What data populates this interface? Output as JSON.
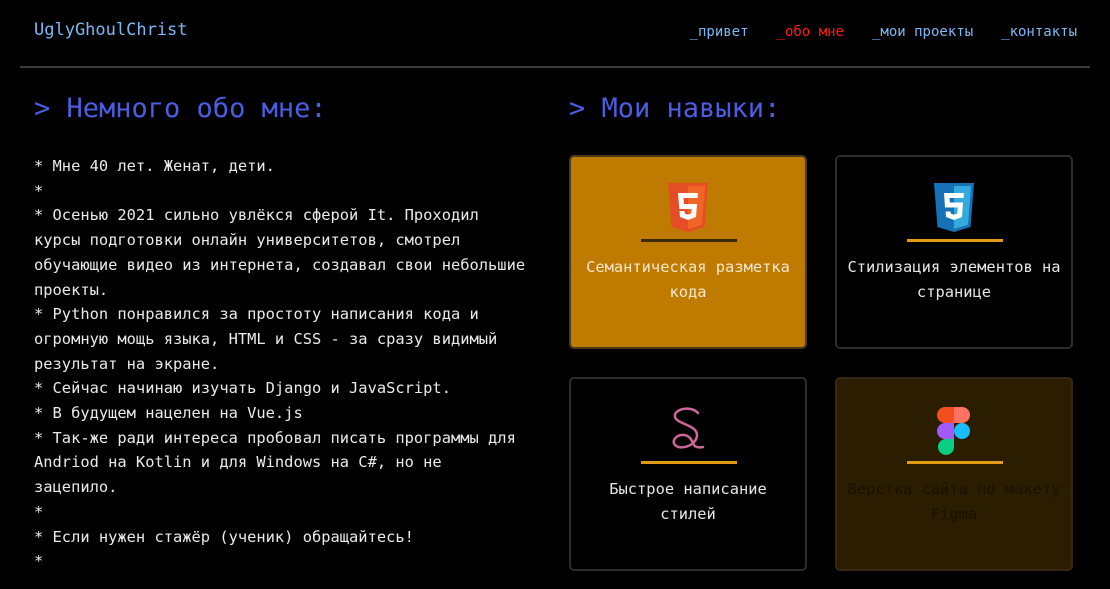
{
  "header": {
    "logo": "UglyGhoulChrist",
    "nav": [
      {
        "label": "_привет"
      },
      {
        "label": "_обо мне"
      },
      {
        "label": "_мои проекты"
      },
      {
        "label": "_контакты"
      }
    ]
  },
  "about": {
    "title": "> Немного обо мне:",
    "lines": [
      "* Мне 40 лет. Женат, дети.",
      "*",
      "* Осенью 2021 сильно увлёкся сферой It. Проходил курсы подготовки онлайн университетов, смотрел обучающие видео из интернета, создавал свои небольшие проекты.",
      "* Python понравился за простоту написания кода и огромную мощь языка, HTML и CSS - за сразу видимый результат на экране.",
      "* Сейчас начинаю изучать Django и JavaScript.",
      "* В будущем нацелен на Vue.js",
      "* Так-же ради интереса пробовал писать программы для Andriod на Kotlin и для Windows на C#, но не зацепило.",
      "*",
      "* Если нужен стажёр (ученик) обращайтесь!",
      "*"
    ]
  },
  "skills": {
    "title": "> Мои навыки:",
    "cards": [
      {
        "label": "Семантическая разметка кода",
        "icon": "html5-icon"
      },
      {
        "label": "Стилизация элементов на странице",
        "icon": "css3-icon"
      },
      {
        "label": "Быстрое написание стилей",
        "icon": "sass-icon"
      },
      {
        "label": "Верстка сайта по макету Figma",
        "icon": "figma-icon"
      }
    ]
  },
  "colors": {
    "accent_title": "#4b5de0",
    "link": "#7ab8f5",
    "active_link": "#ff1a1a",
    "card_bar": "#e09a16",
    "card_active": "#bf7b00"
  }
}
